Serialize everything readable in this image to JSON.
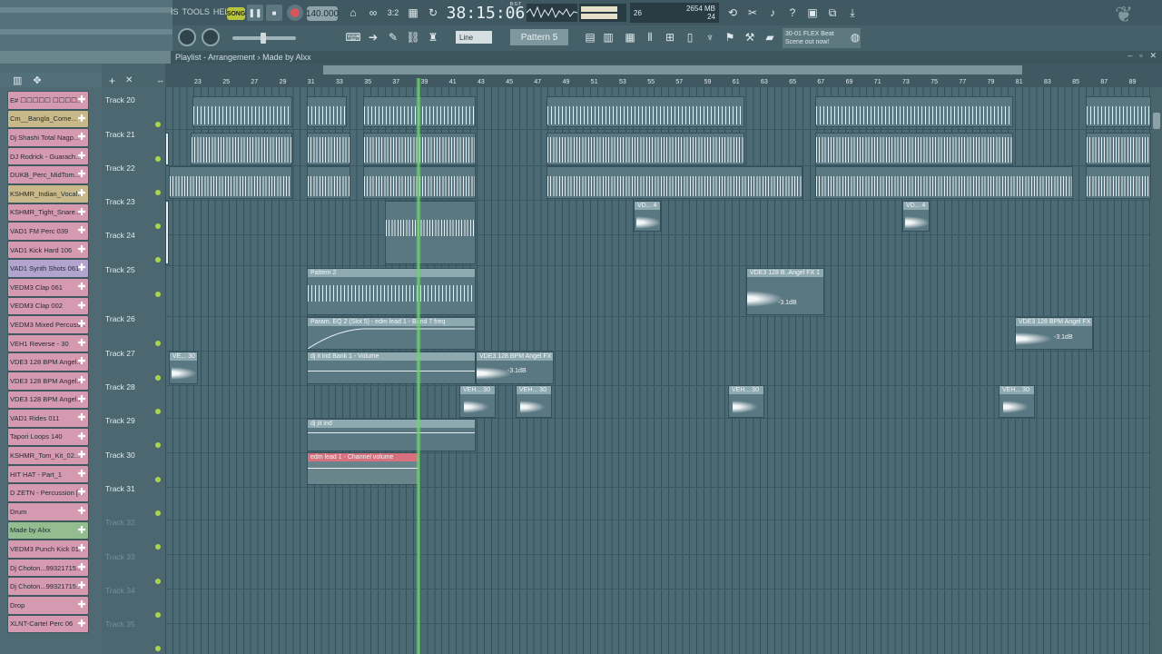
{
  "menus": {
    "items": [
      "IS",
      "TOOLS",
      "HELP"
    ]
  },
  "transport": {
    "mode": "SONG",
    "tempo": "140.000",
    "time": "38:15:06",
    "time_sub": "B:S:T"
  },
  "meters": {
    "mem_top": "26",
    "mem_val": "2654 MB",
    "voices": "24"
  },
  "toolbar": {
    "snap": "Line",
    "pattern": "Pattern 5",
    "hint_line1": "30-01 FLEX Beat",
    "hint_line2": "Scene out now!"
  },
  "playlist": {
    "title": "Playlist - Arrangement",
    "separator": "›",
    "name": "Made by Alxx"
  },
  "ruler": [
    "23",
    "25",
    "27",
    "29",
    "31",
    "33",
    "35",
    "37",
    "39",
    "41",
    "43",
    "45",
    "47",
    "49",
    "51",
    "53",
    "55",
    "57",
    "59",
    "61",
    "63",
    "65",
    "67",
    "69",
    "71",
    "73",
    "75",
    "77",
    "79",
    "81",
    "83",
    "85",
    "87",
    "89"
  ],
  "channels": [
    {
      "label": "E# ☐☐☐☐☐ ☐☐☐☐...",
      "color": "pink"
    },
    {
      "label": "Cm__Bangla_Come...",
      "color": "tan"
    },
    {
      "label": "Dj Shashi Total Nagp...",
      "color": "pink"
    },
    {
      "label": "DJ Rodrick - Guarach...",
      "color": "pink"
    },
    {
      "label": "DUKB_Perc_MidTom...",
      "color": "pink"
    },
    {
      "label": "KSHMR_Indian_Vocal...",
      "color": "tan"
    },
    {
      "label": "KSHMR_Tight_Snare...",
      "color": "pink"
    },
    {
      "label": "VAD1 FM Perc 039",
      "color": "pink"
    },
    {
      "label": "VAD1 Kick Hard 106",
      "color": "pink"
    },
    {
      "label": "VAD1 Synth Shots 061",
      "color": "purple"
    },
    {
      "label": "VEDM3 Clap 061",
      "color": "pink"
    },
    {
      "label": "VEDM3 Clap 002",
      "color": "pink"
    },
    {
      "label": "VEDM3 Mixed Percuss...",
      "color": "pink"
    },
    {
      "label": "VEH1 Reverse - 30",
      "color": "pink"
    },
    {
      "label": "VDE3 128 BPM Angel...",
      "color": "pink"
    },
    {
      "label": "VDE3 128 BPM Angel...",
      "color": "pink"
    },
    {
      "label": "VDE3 128 BPM Angel...",
      "color": "pink"
    },
    {
      "label": "VAD1 Rides 011",
      "color": "pink"
    },
    {
      "label": "Tapori Loops 140",
      "color": "pink"
    },
    {
      "label": "KSHMR_Tom_Kit_02...",
      "color": "pink"
    },
    {
      "label": "HIT HAT - Part_1",
      "color": "pink"
    },
    {
      "label": "D ZETN - Percussion [...",
      "color": "pink"
    },
    {
      "label": "Drum",
      "color": "pink"
    },
    {
      "label": "Made by Alxx",
      "color": "green"
    },
    {
      "label": "VEDM3 Punch Kick 01...",
      "color": "pink"
    },
    {
      "label": "Dj Choton...99321715...",
      "color": "pink"
    },
    {
      "label": "Dj Choton...99321715...",
      "color": "pink"
    },
    {
      "label": "Drop",
      "color": "pink"
    },
    {
      "label": "XLNT-Cartel Perc 06",
      "color": "pink"
    }
  ],
  "tracks": [
    "Track 20",
    "Track 21",
    "Track 22",
    "Track 23",
    "Track 24",
    "Track 25",
    "Track 26",
    "Track 27",
    "Track 28",
    "Track 29",
    "Track 30",
    "Track 31",
    "Track 32",
    "Track 33",
    "Track 34",
    "Track 35"
  ],
  "clips": {
    "pattern2": "Pattern 2",
    "param_eq": "Param. EQ 2 (Slot 5) - edm lead 1 - Band 7 freq",
    "dj_volume": "dj it ind Bank 1 - Volume",
    "dj_jit": "dj jit ind",
    "edm_channel": "edm lead 1 - Channel volume",
    "vde_fx1": "VDE3 128 B..Angel FX 1",
    "vde_fx2": "VDE3 128 BPM Angel FX 1",
    "vde_fx3": "VDE3 128 BPM Angel FX 1",
    "db": "-3.1dB",
    "veh": "VEH... 30",
    "ve": "VE... 30",
    "vd": "VD... 4"
  }
}
